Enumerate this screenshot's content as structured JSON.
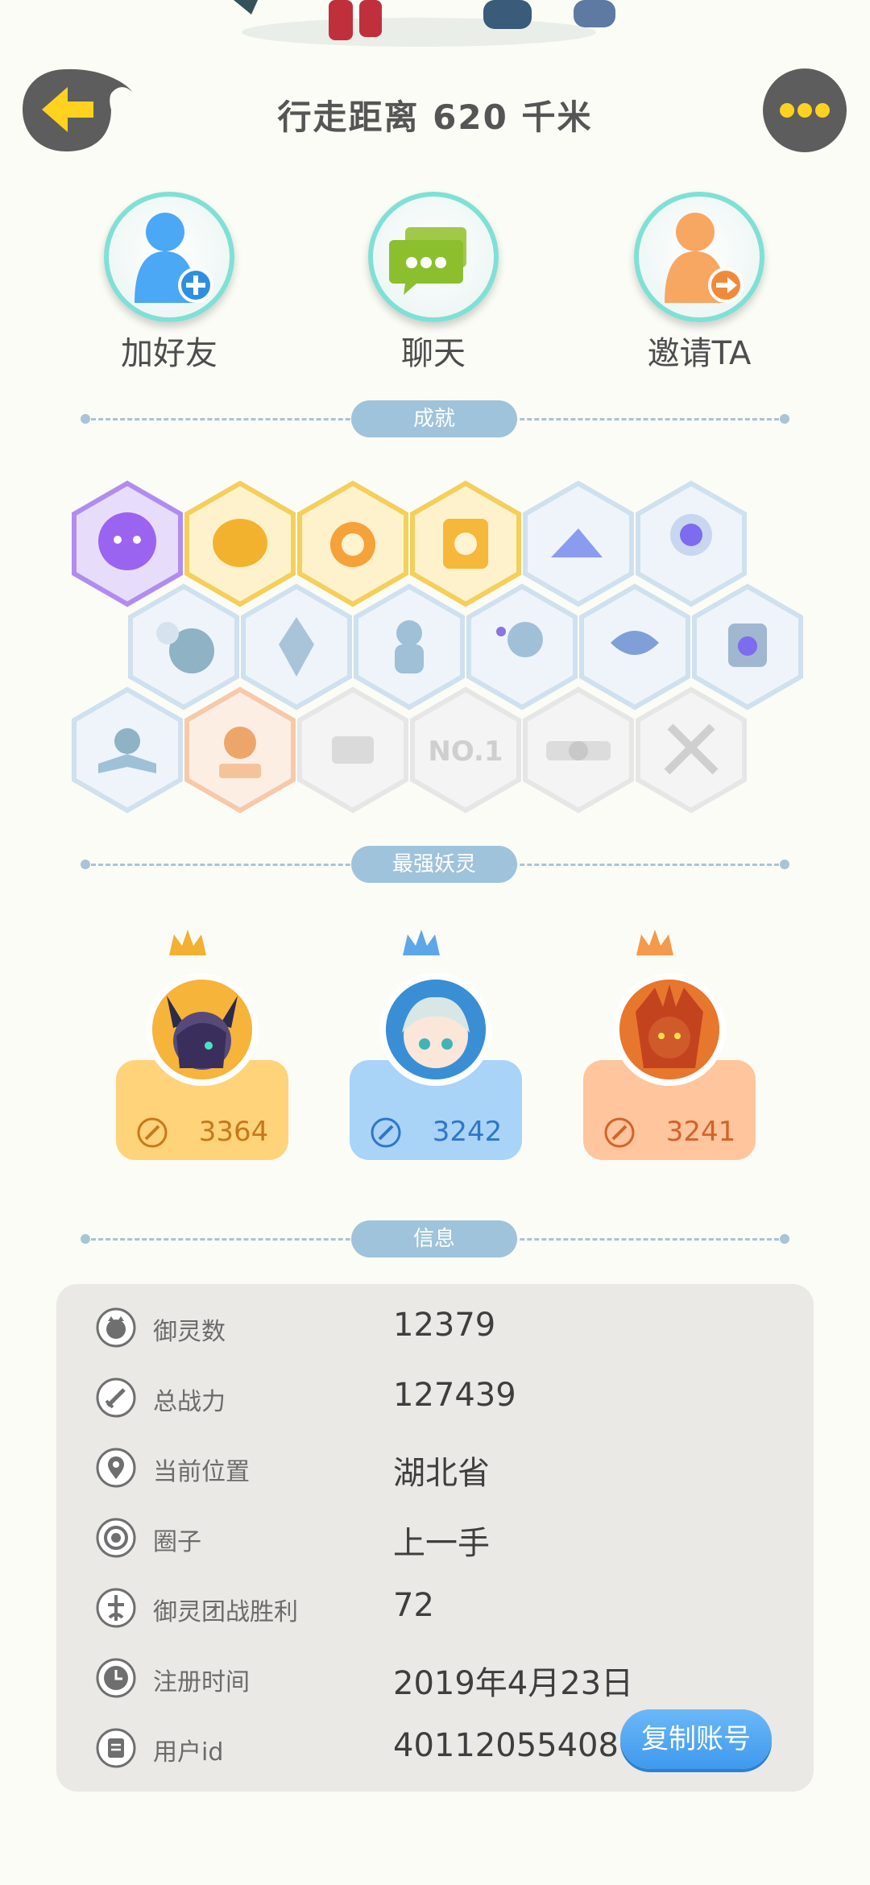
{
  "header": {
    "title": "行走距离 620 千米"
  },
  "actions": [
    {
      "label": "加好友",
      "icon": "add-friend-icon"
    },
    {
      "label": "聊天",
      "icon": "chat-icon"
    },
    {
      "label": "邀请TA",
      "icon": "invite-icon"
    }
  ],
  "sections": {
    "achievements": "成就",
    "strongest": "最强妖灵",
    "info": "信息"
  },
  "spirits": [
    {
      "power": "3364",
      "color": "#ffd37a",
      "text_color": "#c9781a"
    },
    {
      "power": "3242",
      "color": "#a9d3f7",
      "text_color": "#2e77c6"
    },
    {
      "power": "3241",
      "color": "#ffc59d",
      "text_color": "#d2642a"
    }
  ],
  "info": {
    "rows": [
      {
        "label": "御灵数",
        "value": "12379",
        "icon": "spirit-count-icon"
      },
      {
        "label": "总战力",
        "value": "127439",
        "icon": "sword-icon"
      },
      {
        "label": "当前位置",
        "value": "湖北省",
        "icon": "location-pin-icon"
      },
      {
        "label": "圈子",
        "value": "上一手",
        "icon": "circle-group-icon"
      },
      {
        "label": "御灵团战胜利",
        "value": "72",
        "icon": "team-battle-icon"
      },
      {
        "label": "注册时间",
        "value": "2019年4月23日",
        "icon": "clock-icon"
      },
      {
        "label": "用户id",
        "value": "40112055408",
        "icon": "id-card-icon"
      }
    ],
    "copy_label": "复制账号"
  }
}
